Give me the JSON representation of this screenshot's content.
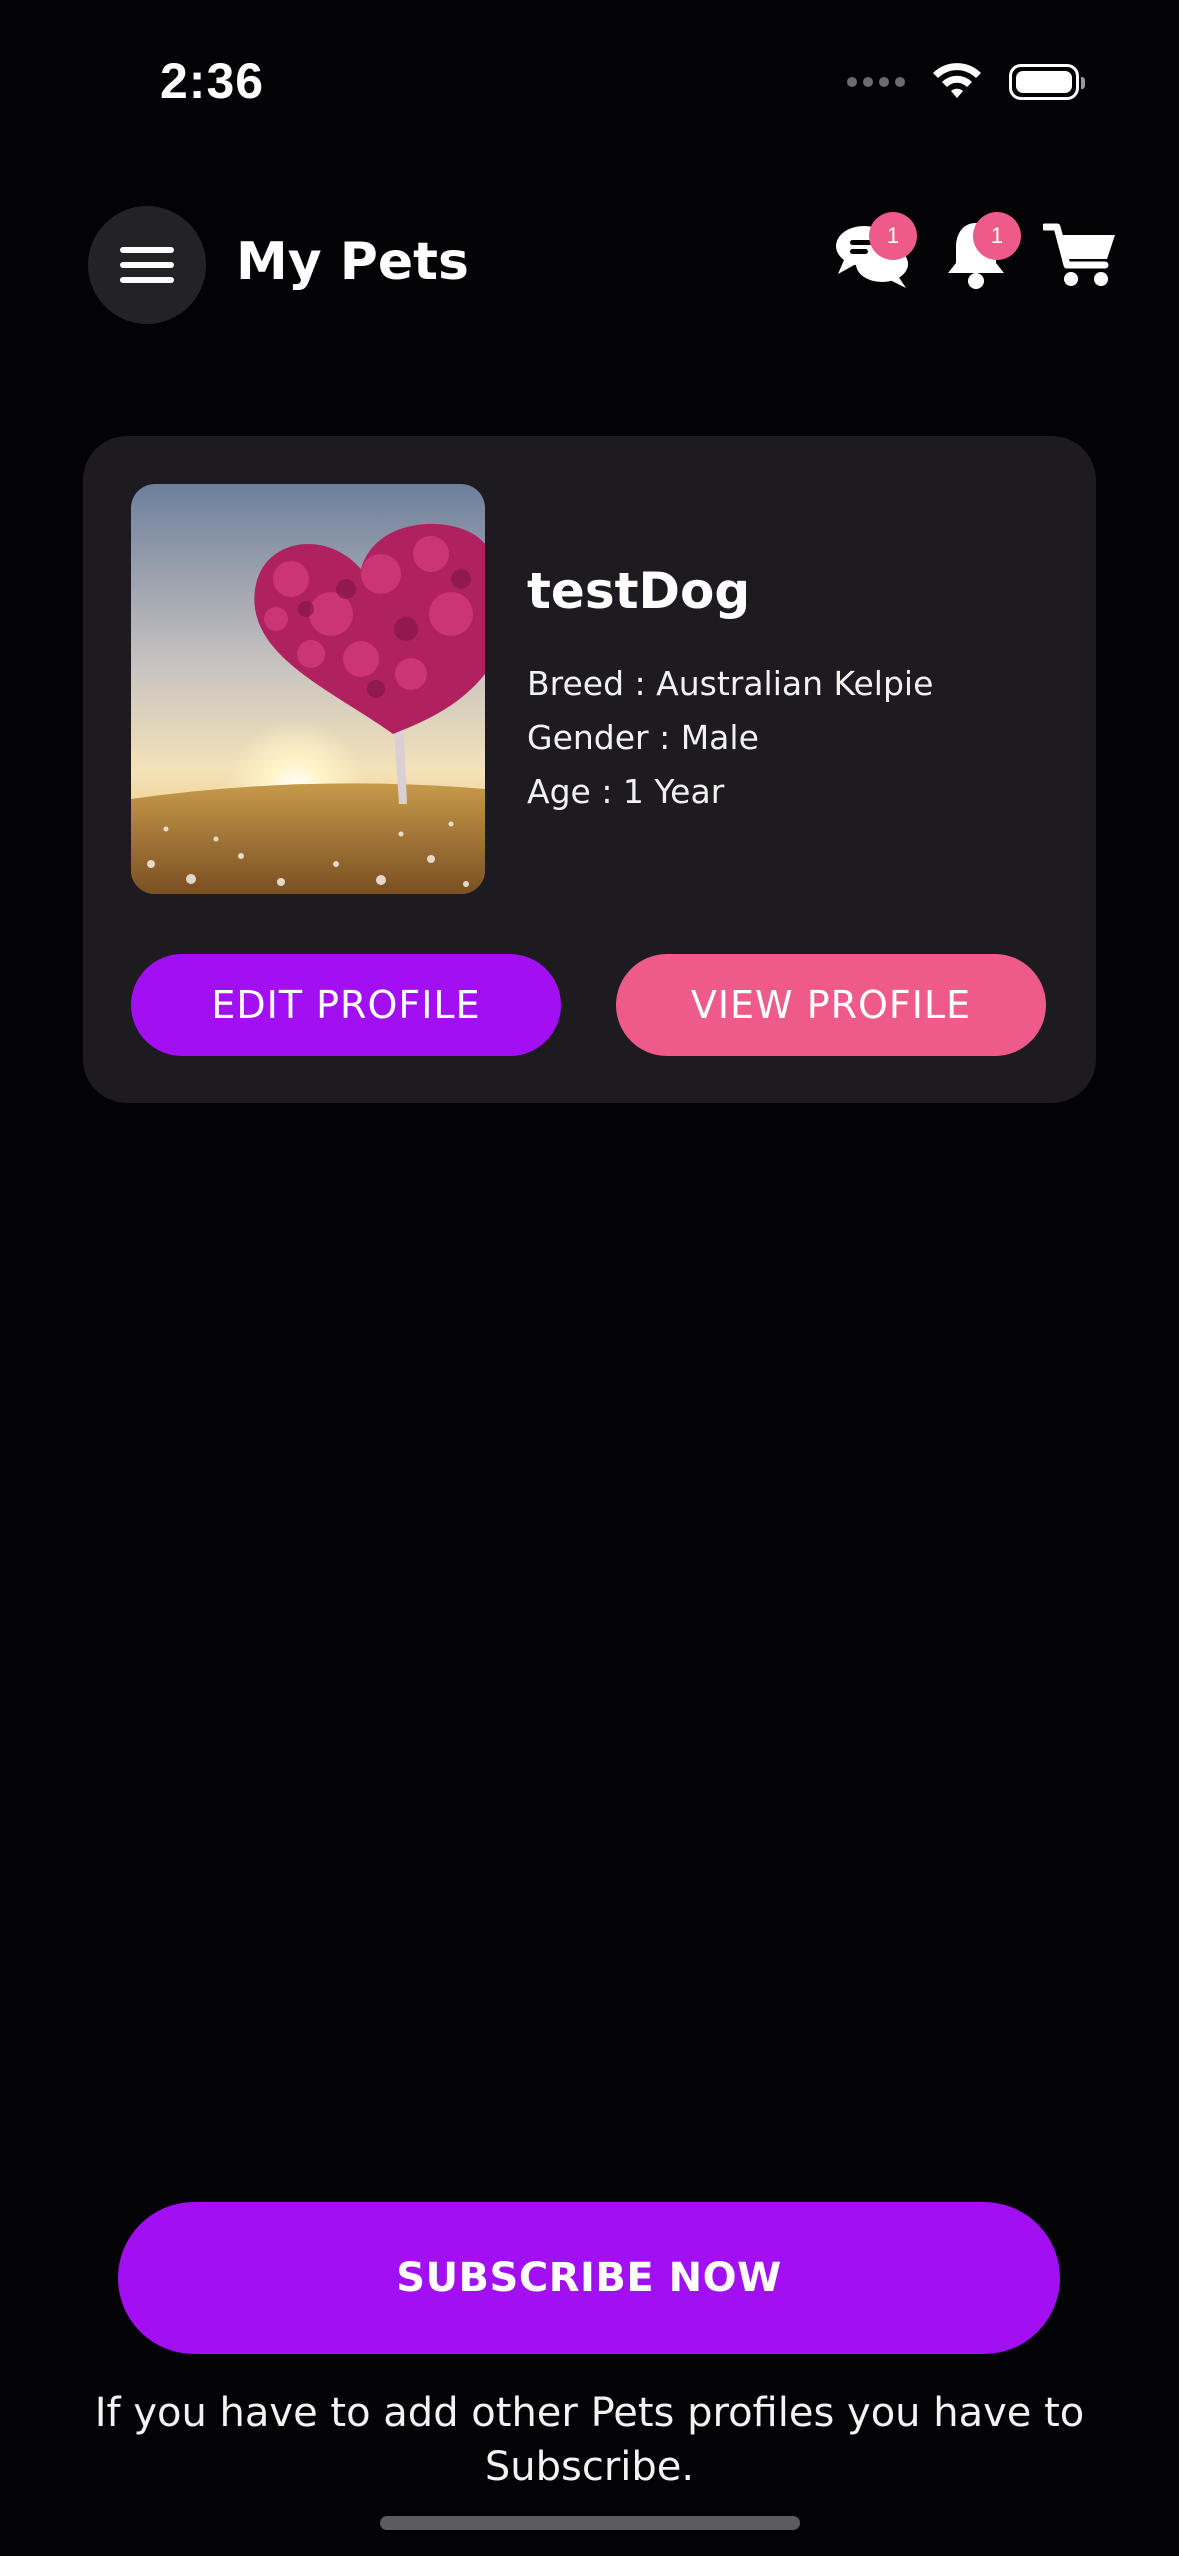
{
  "status_bar": {
    "time": "2:36"
  },
  "header": {
    "title": "My Pets",
    "chat_badge": "1",
    "notification_badge": "1"
  },
  "pet": {
    "name": "testDog",
    "breed": "Breed : Australian Kelpie",
    "gender": "Gender : Male",
    "age": "Age : 1 Year",
    "edit_label": "EDIT PROFILE",
    "view_label": "VIEW PROFILE"
  },
  "subscribe": {
    "button_label": "SUBSCRIBE NOW",
    "note": "If you have to add other Pets profiles you have to Subscribe."
  },
  "colors": {
    "primary_purple": "#a20ff2",
    "accent_pink": "#ee5a8a",
    "card_bg": "#1d1b1f",
    "background": "#030204"
  },
  "icons": [
    "menu-icon",
    "chat-icon",
    "bell-icon",
    "cart-icon",
    "wifi-icon",
    "battery-icon"
  ]
}
